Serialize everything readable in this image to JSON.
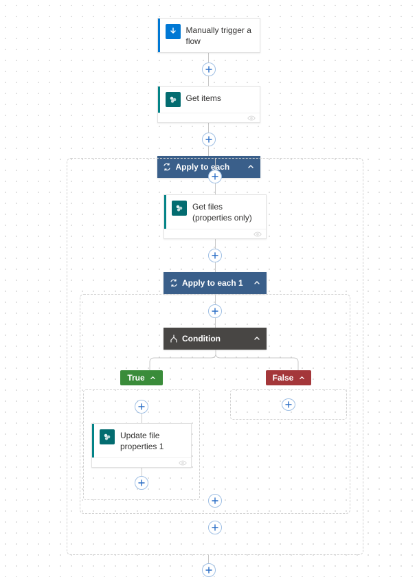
{
  "trigger": {
    "title": "Manually trigger a flow"
  },
  "get_items": {
    "title": "Get items"
  },
  "apply_each": {
    "title": "Apply to each"
  },
  "get_files": {
    "title": "Get files (properties only)"
  },
  "apply_each_1": {
    "title": "Apply to each 1"
  },
  "condition": {
    "title": "Condition"
  },
  "branch_true": {
    "label": "True"
  },
  "branch_false": {
    "label": "False"
  },
  "update_file": {
    "title": "Update file properties 1"
  }
}
